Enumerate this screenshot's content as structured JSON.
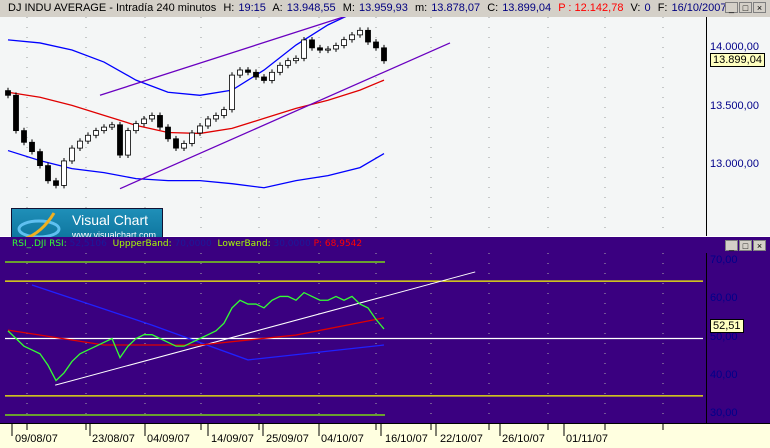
{
  "header": {
    "symbol": "DJ INDU AVERAGE - Intradía 240 minutos",
    "h_label": "H:",
    "h": "19:15",
    "a_label": "A:",
    "a": "13.948,55",
    "M_label": "M:",
    "M": "13.959,93",
    "m_label": "m:",
    "m": "13.878,07",
    "c_label": "C:",
    "c": "13.899,04",
    "p": "P : 12.142,78",
    "v_label": "V:",
    "v": "0",
    "f_label": "F:",
    "f": "16/10/2007"
  },
  "window_buttons": {
    "minimize": "_",
    "maximize": "□",
    "close": "×"
  },
  "logo": {
    "title": "Visual Chart",
    "url": "www.visualchart.com"
  },
  "price_axis": {
    "ticks": [
      "14.000,00",
      "13.500,00",
      "13.000,00"
    ],
    "last": "13.899,04"
  },
  "rsi": {
    "label": "RSI_.DJI RSI:",
    "rsi": "52,5106",
    "upper_label": "UppperBand:",
    "upper": "70,0000",
    "lower_label": "LowerBand:",
    "lower": "30,0000",
    "p": "P: 68,9542",
    "ticks": [
      "70,00",
      "60,00",
      "50,00",
      "40,00",
      "30,00"
    ],
    "last": "52,51"
  },
  "dates": [
    "09/08/07",
    "23/08/07",
    "04/09/07",
    "14/09/07",
    "25/09/07",
    "04/10/07",
    "16/10/07",
    "22/10/07",
    "26/10/07",
    "01/11/07"
  ],
  "colors": {
    "price_bg": "#f4f6f6",
    "rsi_bg": "#3a0080",
    "rsi_line": "#33ff33",
    "ma": "#e00000",
    "band": "#0000ff",
    "channel": "#6a00c0"
  },
  "chart_data": [
    {
      "type": "candlestick",
      "title": "DJ INDU AVERAGE",
      "ylim": [
        12600,
        14300
      ],
      "closes": [
        13603,
        13300,
        13200,
        13120,
        13000,
        12870,
        12830,
        13040,
        13150,
        13210,
        13260,
        13300,
        13330,
        13350,
        13090,
        13300,
        13360,
        13400,
        13430,
        13330,
        13230,
        13150,
        13190,
        13280,
        13340,
        13400,
        13430,
        13480,
        13776,
        13820,
        13800,
        13760,
        13730,
        13800,
        13860,
        13900,
        13920,
        14078,
        14010,
        13990,
        14000,
        14030,
        14080,
        14121,
        14160,
        14060,
        14010,
        13899
      ],
      "upper_band": [
        [
          0,
          14078
        ],
        [
          4,
          14052
        ],
        [
          8,
          13991
        ],
        [
          12,
          13888
        ],
        [
          16,
          13733
        ],
        [
          20,
          13629
        ],
        [
          24,
          13603
        ],
        [
          28,
          13647
        ],
        [
          32,
          13819
        ],
        [
          36,
          14034
        ],
        [
          40,
          14207
        ],
        [
          44,
          14336
        ]
      ],
      "lower_band": [
        [
          0,
          13129
        ],
        [
          4,
          13043
        ],
        [
          8,
          12974
        ],
        [
          12,
          12940
        ],
        [
          16,
          12888
        ],
        [
          20,
          12871
        ],
        [
          24,
          12871
        ],
        [
          28,
          12845
        ],
        [
          32,
          12810
        ],
        [
          36,
          12871
        ],
        [
          40,
          12914
        ],
        [
          44,
          12983
        ],
        [
          47,
          13103
        ]
      ],
      "moving_average": [
        [
          0,
          13629
        ],
        [
          4,
          13586
        ],
        [
          8,
          13517
        ],
        [
          12,
          13431
        ],
        [
          16,
          13345
        ],
        [
          20,
          13284
        ],
        [
          24,
          13276
        ],
        [
          28,
          13319
        ],
        [
          32,
          13405
        ],
        [
          36,
          13491
        ],
        [
          40,
          13560
        ],
        [
          44,
          13647
        ],
        [
          47,
          13733
        ]
      ],
      "channel_lines": [
        [
          [
            11.5,
            13603
          ],
          [
            42.75,
            14293
          ]
        ],
        [
          [
            14,
            12802
          ],
          [
            55.25,
            14052
          ]
        ]
      ]
    },
    {
      "type": "line",
      "title": "RSI",
      "ylim": [
        27,
        73
      ],
      "rsi": [
        52,
        50,
        48,
        47,
        46,
        43,
        39,
        41,
        44,
        46,
        47,
        48,
        49,
        50,
        45,
        48,
        50,
        51,
        51,
        50,
        49,
        48,
        48,
        49,
        50,
        51,
        52,
        54,
        58,
        60,
        59,
        59,
        58,
        60,
        61,
        61,
        60,
        62,
        61,
        60,
        60,
        61,
        60,
        61,
        59,
        58,
        55,
        52.5
      ],
      "rsi_average": [
        [
          0,
          52.2
        ],
        [
          12,
          48.3
        ],
        [
          24,
          48.3
        ],
        [
          36,
          50.9
        ],
        [
          47,
          55.4
        ]
      ],
      "rsi_band": [
        [
          3,
          64
        ],
        [
          18,
          53.5
        ],
        [
          30,
          44.4
        ],
        [
          47,
          48.3
        ]
      ],
      "trend_line": [
        [
          5.9,
          37.8
        ],
        [
          58.4,
          67.4
        ]
      ],
      "levels": [
        {
          "value": 70,
          "color": "#88ff00"
        },
        {
          "value": 65,
          "color": "#ffff00"
        },
        {
          "value": 50,
          "color": "#ffffff"
        },
        {
          "value": 35,
          "color": "#ffff00"
        },
        {
          "value": 30,
          "color": "#88ff00"
        }
      ]
    }
  ]
}
